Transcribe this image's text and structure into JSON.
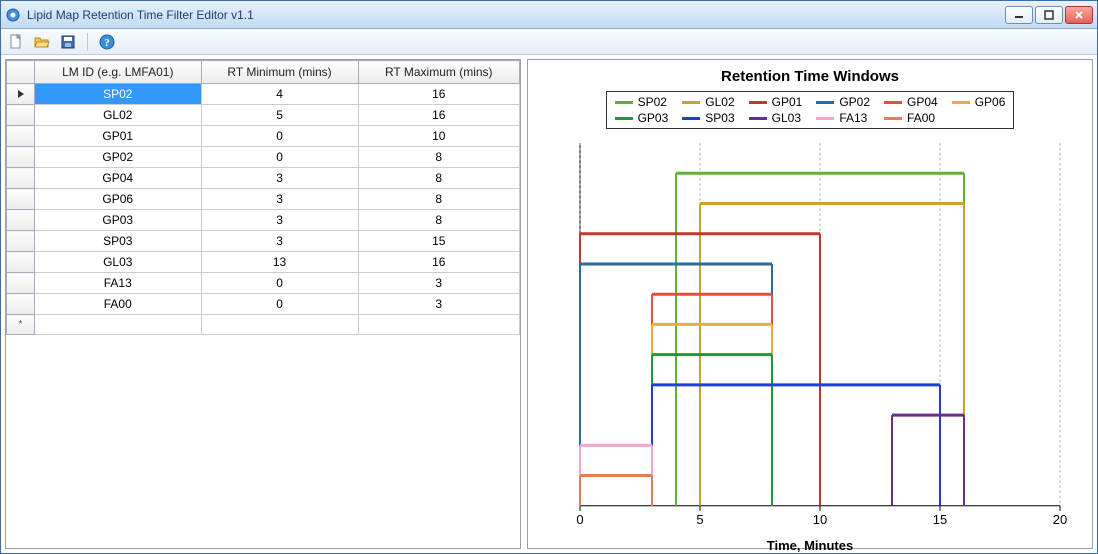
{
  "window": {
    "title": "Lipid Map Retention Time Filter Editor v1.1"
  },
  "toolbar": {
    "new_tooltip": "New",
    "open_tooltip": "Open",
    "save_tooltip": "Save",
    "help_tooltip": "Help"
  },
  "grid": {
    "columns": {
      "id": "LM ID (e.g. LMFA01)",
      "rtmin": "RT Minimum (mins)",
      "rtmax": "RT Maximum (mins)"
    },
    "rows": [
      {
        "id": "SP02",
        "rtmin": 4,
        "rtmax": 16,
        "selected": true
      },
      {
        "id": "GL02",
        "rtmin": 5,
        "rtmax": 16
      },
      {
        "id": "GP01",
        "rtmin": 0,
        "rtmax": 10
      },
      {
        "id": "GP02",
        "rtmin": 0,
        "rtmax": 8
      },
      {
        "id": "GP04",
        "rtmin": 3,
        "rtmax": 8
      },
      {
        "id": "GP06",
        "rtmin": 3,
        "rtmax": 8
      },
      {
        "id": "GP03",
        "rtmin": 3,
        "rtmax": 8
      },
      {
        "id": "SP03",
        "rtmin": 3,
        "rtmax": 15
      },
      {
        "id": "GL03",
        "rtmin": 13,
        "rtmax": 16
      },
      {
        "id": "FA13",
        "rtmin": 0,
        "rtmax": 3
      },
      {
        "id": "FA00",
        "rtmin": 0,
        "rtmax": 3
      }
    ]
  },
  "chart_data": {
    "type": "bar",
    "title": "Retention Time Windows",
    "xlabel": "Time, Minutes",
    "ylabel": "",
    "xlim": [
      0,
      20
    ],
    "xticks": [
      0,
      5,
      10,
      15,
      20
    ],
    "legend": [
      "SP02",
      "GL02",
      "GP01",
      "GP02",
      "GP04",
      "GP06",
      "GP03",
      "SP03",
      "GL03",
      "FA13",
      "FA00"
    ],
    "colors": {
      "SP02": "#5fb233",
      "GL02": "#caa32c",
      "GP01": "#c0392b",
      "GP02": "#2b6aa3",
      "GP04": "#e74c3c",
      "GP06": "#f1a93c",
      "GP03": "#199b3a",
      "SP03": "#1f3fd6",
      "GL03": "#6b2d8a",
      "FA13": "#f2a4cf",
      "FA00": "#e67e5a"
    },
    "series": [
      {
        "name": "SP02",
        "start": 4,
        "end": 16
      },
      {
        "name": "GL02",
        "start": 5,
        "end": 16
      },
      {
        "name": "GP01",
        "start": 0,
        "end": 10
      },
      {
        "name": "GP02",
        "start": 0,
        "end": 8
      },
      {
        "name": "GP04",
        "start": 3,
        "end": 8
      },
      {
        "name": "GP06",
        "start": 3,
        "end": 8
      },
      {
        "name": "GP03",
        "start": 3,
        "end": 8
      },
      {
        "name": "SP03",
        "start": 3,
        "end": 15
      },
      {
        "name": "GL03",
        "start": 13,
        "end": 16
      },
      {
        "name": "FA13",
        "start": 0,
        "end": 3
      },
      {
        "name": "FA00",
        "start": 0,
        "end": 3
      }
    ]
  }
}
